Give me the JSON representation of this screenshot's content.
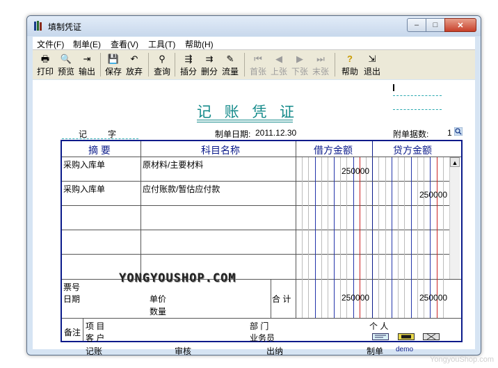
{
  "window": {
    "title": "填制凭证",
    "controls": {
      "minimize": "–",
      "maximize": "□",
      "close": "✕"
    }
  },
  "menu": [
    "文件(F)",
    "制单(E)",
    "查看(V)",
    "工具(T)",
    "帮助(H)"
  ],
  "toolbar": {
    "buttons": [
      {
        "label": "打印",
        "icon": "printer-icon",
        "glyph": "🖶",
        "enabled": true
      },
      {
        "label": "预览",
        "icon": "preview-icon",
        "glyph": "🔍",
        "enabled": true
      },
      {
        "label": "输出",
        "icon": "export-icon",
        "glyph": "⇥",
        "enabled": true
      },
      {
        "label": "保存",
        "icon": "save-icon",
        "glyph": "💾",
        "enabled": true
      },
      {
        "label": "放弃",
        "icon": "undo-icon",
        "glyph": "↶",
        "enabled": true
      },
      {
        "label": "查询",
        "icon": "binoculars-icon",
        "glyph": "⚲",
        "enabled": true
      },
      {
        "label": "插分",
        "icon": "insert-row-icon",
        "glyph": "⇶",
        "enabled": true
      },
      {
        "label": "删分",
        "icon": "delete-row-icon",
        "glyph": "⇉",
        "enabled": true
      },
      {
        "label": "流量",
        "icon": "flow-icon",
        "glyph": "✎",
        "enabled": true
      },
      {
        "label": "首张",
        "icon": "first-icon",
        "glyph": "⏮",
        "enabled": false
      },
      {
        "label": "上张",
        "icon": "prev-icon",
        "glyph": "◀",
        "enabled": false
      },
      {
        "label": "下张",
        "icon": "next-icon",
        "glyph": "▶",
        "enabled": false
      },
      {
        "label": "末张",
        "icon": "last-icon",
        "glyph": "⏭",
        "enabled": false
      },
      {
        "label": "帮助",
        "icon": "help-icon",
        "glyph": "?",
        "enabled": true
      },
      {
        "label": "退出",
        "icon": "exit-icon",
        "glyph": "⇲",
        "enabled": true
      }
    ]
  },
  "voucher": {
    "title": "记 账 凭 证",
    "type_label": "记",
    "number_label": "字",
    "date_label": "制单日期:",
    "date_value": "2011.12.30",
    "attachments_label": "附单据数:",
    "attachments_value": "1",
    "headers": {
      "summary": "摘 要",
      "account": "科目名称",
      "debit": "借方金额",
      "credit": "贷方金额"
    },
    "rows": [
      {
        "summary": "采购入库单",
        "account": "原材料/主要材料",
        "debit": "250000",
        "credit": ""
      },
      {
        "summary": "采购入库单",
        "account": "应付账款/暂估应付款",
        "debit": "",
        "credit": "250000"
      }
    ],
    "ticket_label": "票号",
    "date_field_label": "日期",
    "unit_price_label": "单价",
    "quantity_label": "数量",
    "total_label": "合 计",
    "total_debit": "250000",
    "total_credit": "250000",
    "remarks_label": "备注",
    "project_label": "项 目",
    "customer_label": "客 户",
    "department_label": "部 门",
    "salesperson_label": "业务员",
    "individual_label": "个 人",
    "bookkeeper_label": "记账",
    "reviewer_label": "审核",
    "cashier_label": "出纳",
    "maker_label": "制单",
    "maker_value": "demo"
  },
  "watermark": "YONGYOUSHOP.COM",
  "footer_watermark": "YongyouShop.com",
  "colors": {
    "accent": "#138a8a",
    "grid_border": "#0a1a8a",
    "red_line": "#cc2222",
    "blue_line": "#2233aa"
  }
}
